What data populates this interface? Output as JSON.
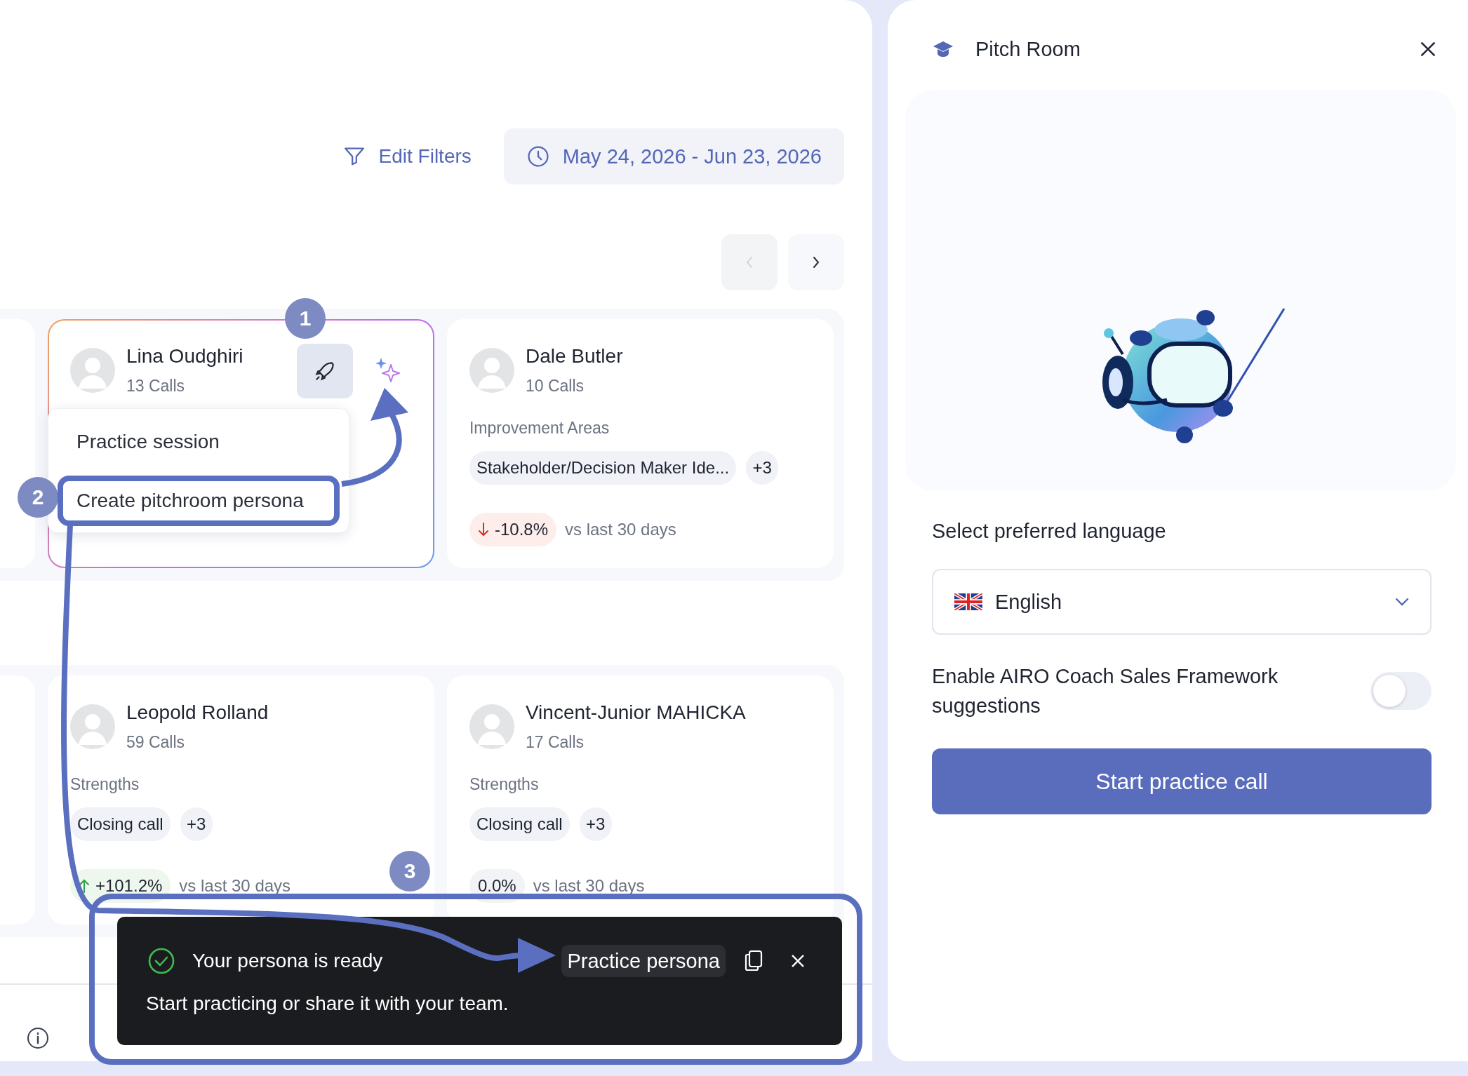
{
  "filters": {
    "edit_label": "Edit Filters",
    "date_range": "May 24, 2026 - Jun 23, 2026"
  },
  "pager": [
    {
      "kind": "prev",
      "disabled": true
    },
    {
      "kind": "next",
      "disabled": false
    }
  ],
  "card_rows": [
    [
      {
        "name": "Lina Oudghiri",
        "calls": "13 Calls",
        "highlighted": true
      },
      {
        "name": "Dale Butler",
        "calls": "10 Calls",
        "highlighted": false,
        "section_label": "Improvement Areas",
        "tags": [
          "Stakeholder/Decision Maker Ide..."
        ],
        "more": "+3",
        "delta": {
          "value": "-10.8%",
          "kind": "down"
        },
        "compare": "vs last 30 days"
      }
    ],
    [
      {
        "name": "Leopold Rolland",
        "calls": "59 Calls",
        "highlighted": false,
        "section_label": "Strengths",
        "tags": [
          "Closing call"
        ],
        "more": "+3",
        "delta": {
          "value": "+101.2%",
          "kind": "up"
        },
        "compare": "vs last 30 days"
      },
      {
        "name": "Vincent-Junior MAHICKA",
        "calls": "17 Calls",
        "highlighted": false,
        "section_label": "Strengths",
        "tags": [
          "Closing call"
        ],
        "more": "+3",
        "delta": {
          "value": "0.0%",
          "kind": "flat"
        },
        "compare": "vs last 30 days"
      }
    ]
  ],
  "menu": {
    "items": [
      {
        "label": "Practice session",
        "highlighted": false
      },
      {
        "label": "Create pitchroom persona",
        "highlighted": true
      }
    ]
  },
  "steps": [
    "1",
    "2",
    "3"
  ],
  "toast": {
    "title": "Your persona is ready",
    "action": "Practice persona",
    "message": "Start practicing or share it with your team."
  },
  "panel": {
    "title": "Pitch Room",
    "language_label": "Select preferred language",
    "language": "English",
    "framework_label": "Enable AIRO Coach Sales Framework suggestions",
    "framework_on": false,
    "start_button": "Start practice call"
  }
}
